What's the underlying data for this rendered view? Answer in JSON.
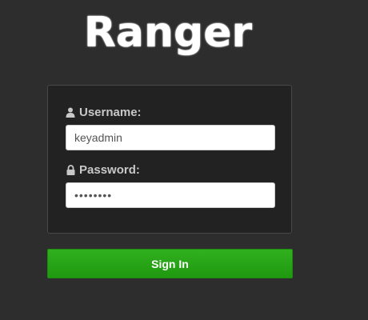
{
  "logo": {
    "text": "Ranger"
  },
  "login": {
    "username_label": "Username:",
    "username_value": "keyadmin",
    "password_label": "Password:",
    "password_value": "********",
    "username_icon": "user-icon",
    "password_icon": "lock-icon"
  },
  "actions": {
    "signin_label": "Sign In"
  },
  "colors": {
    "background": "#2d2d2d",
    "panel": "#222222",
    "button": "#25a315",
    "label": "#c8c8c8"
  }
}
